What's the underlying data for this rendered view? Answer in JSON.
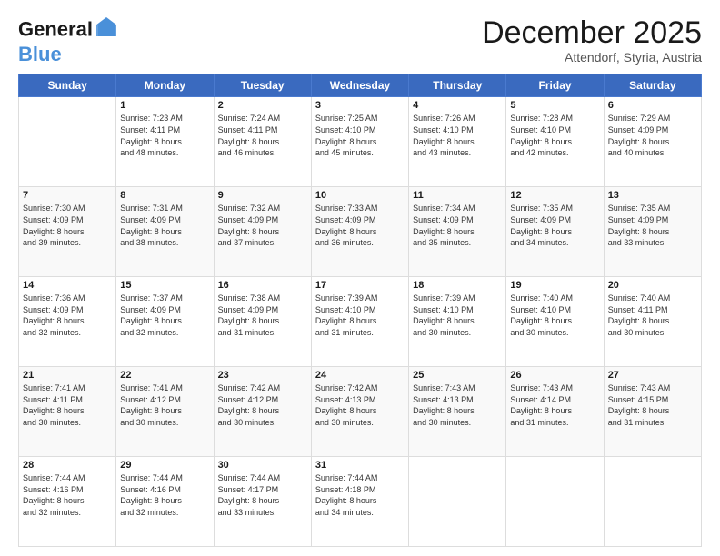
{
  "header": {
    "logo_line1": "General",
    "logo_line2": "Blue",
    "month": "December 2025",
    "location": "Attendorf, Styria, Austria"
  },
  "weekdays": [
    "Sunday",
    "Monday",
    "Tuesday",
    "Wednesday",
    "Thursday",
    "Friday",
    "Saturday"
  ],
  "rows": [
    [
      {
        "day": "",
        "content": ""
      },
      {
        "day": "1",
        "content": "Sunrise: 7:23 AM\nSunset: 4:11 PM\nDaylight: 8 hours\nand 48 minutes."
      },
      {
        "day": "2",
        "content": "Sunrise: 7:24 AM\nSunset: 4:11 PM\nDaylight: 8 hours\nand 46 minutes."
      },
      {
        "day": "3",
        "content": "Sunrise: 7:25 AM\nSunset: 4:10 PM\nDaylight: 8 hours\nand 45 minutes."
      },
      {
        "day": "4",
        "content": "Sunrise: 7:26 AM\nSunset: 4:10 PM\nDaylight: 8 hours\nand 43 minutes."
      },
      {
        "day": "5",
        "content": "Sunrise: 7:28 AM\nSunset: 4:10 PM\nDaylight: 8 hours\nand 42 minutes."
      },
      {
        "day": "6",
        "content": "Sunrise: 7:29 AM\nSunset: 4:09 PM\nDaylight: 8 hours\nand 40 minutes."
      }
    ],
    [
      {
        "day": "7",
        "content": "Sunrise: 7:30 AM\nSunset: 4:09 PM\nDaylight: 8 hours\nand 39 minutes."
      },
      {
        "day": "8",
        "content": "Sunrise: 7:31 AM\nSunset: 4:09 PM\nDaylight: 8 hours\nand 38 minutes."
      },
      {
        "day": "9",
        "content": "Sunrise: 7:32 AM\nSunset: 4:09 PM\nDaylight: 8 hours\nand 37 minutes."
      },
      {
        "day": "10",
        "content": "Sunrise: 7:33 AM\nSunset: 4:09 PM\nDaylight: 8 hours\nand 36 minutes."
      },
      {
        "day": "11",
        "content": "Sunrise: 7:34 AM\nSunset: 4:09 PM\nDaylight: 8 hours\nand 35 minutes."
      },
      {
        "day": "12",
        "content": "Sunrise: 7:35 AM\nSunset: 4:09 PM\nDaylight: 8 hours\nand 34 minutes."
      },
      {
        "day": "13",
        "content": "Sunrise: 7:35 AM\nSunset: 4:09 PM\nDaylight: 8 hours\nand 33 minutes."
      }
    ],
    [
      {
        "day": "14",
        "content": "Sunrise: 7:36 AM\nSunset: 4:09 PM\nDaylight: 8 hours\nand 32 minutes."
      },
      {
        "day": "15",
        "content": "Sunrise: 7:37 AM\nSunset: 4:09 PM\nDaylight: 8 hours\nand 32 minutes."
      },
      {
        "day": "16",
        "content": "Sunrise: 7:38 AM\nSunset: 4:09 PM\nDaylight: 8 hours\nand 31 minutes."
      },
      {
        "day": "17",
        "content": "Sunrise: 7:39 AM\nSunset: 4:10 PM\nDaylight: 8 hours\nand 31 minutes."
      },
      {
        "day": "18",
        "content": "Sunrise: 7:39 AM\nSunset: 4:10 PM\nDaylight: 8 hours\nand 30 minutes."
      },
      {
        "day": "19",
        "content": "Sunrise: 7:40 AM\nSunset: 4:10 PM\nDaylight: 8 hours\nand 30 minutes."
      },
      {
        "day": "20",
        "content": "Sunrise: 7:40 AM\nSunset: 4:11 PM\nDaylight: 8 hours\nand 30 minutes."
      }
    ],
    [
      {
        "day": "21",
        "content": "Sunrise: 7:41 AM\nSunset: 4:11 PM\nDaylight: 8 hours\nand 30 minutes."
      },
      {
        "day": "22",
        "content": "Sunrise: 7:41 AM\nSunset: 4:12 PM\nDaylight: 8 hours\nand 30 minutes."
      },
      {
        "day": "23",
        "content": "Sunrise: 7:42 AM\nSunset: 4:12 PM\nDaylight: 8 hours\nand 30 minutes."
      },
      {
        "day": "24",
        "content": "Sunrise: 7:42 AM\nSunset: 4:13 PM\nDaylight: 8 hours\nand 30 minutes."
      },
      {
        "day": "25",
        "content": "Sunrise: 7:43 AM\nSunset: 4:13 PM\nDaylight: 8 hours\nand 30 minutes."
      },
      {
        "day": "26",
        "content": "Sunrise: 7:43 AM\nSunset: 4:14 PM\nDaylight: 8 hours\nand 31 minutes."
      },
      {
        "day": "27",
        "content": "Sunrise: 7:43 AM\nSunset: 4:15 PM\nDaylight: 8 hours\nand 31 minutes."
      }
    ],
    [
      {
        "day": "28",
        "content": "Sunrise: 7:44 AM\nSunset: 4:16 PM\nDaylight: 8 hours\nand 32 minutes."
      },
      {
        "day": "29",
        "content": "Sunrise: 7:44 AM\nSunset: 4:16 PM\nDaylight: 8 hours\nand 32 minutes."
      },
      {
        "day": "30",
        "content": "Sunrise: 7:44 AM\nSunset: 4:17 PM\nDaylight: 8 hours\nand 33 minutes."
      },
      {
        "day": "31",
        "content": "Sunrise: 7:44 AM\nSunset: 4:18 PM\nDaylight: 8 hours\nand 34 minutes."
      },
      {
        "day": "",
        "content": ""
      },
      {
        "day": "",
        "content": ""
      },
      {
        "day": "",
        "content": ""
      }
    ]
  ]
}
